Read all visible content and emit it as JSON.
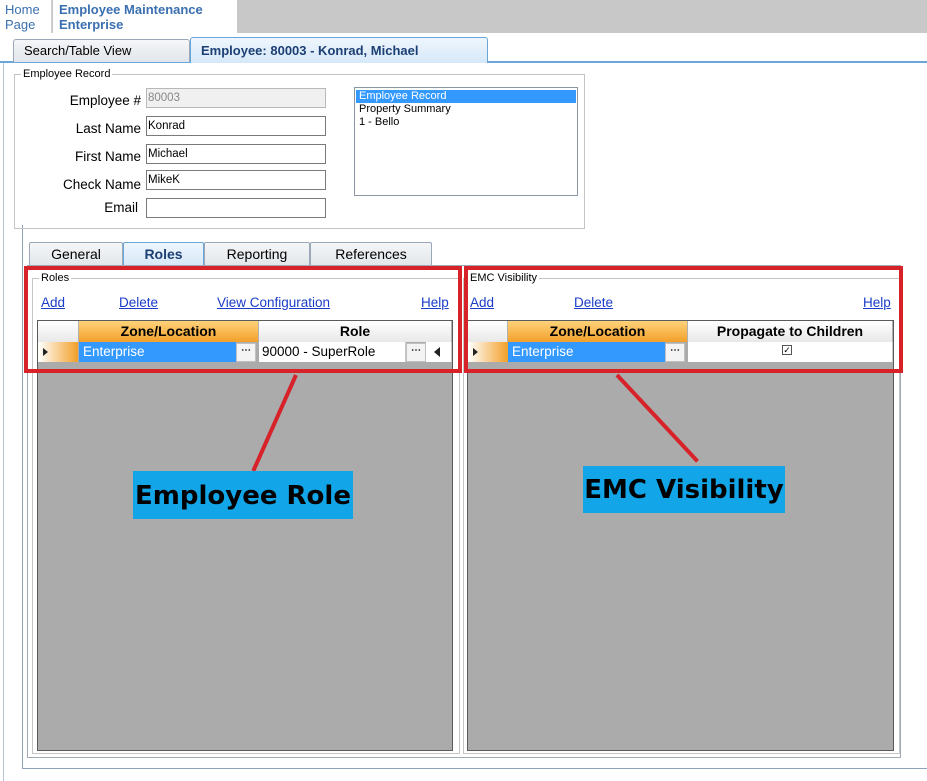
{
  "breadcrumb": {
    "home_line1": "Home",
    "home_line2": "Page",
    "current_line1": "Employee Maintenance",
    "current_line2": "Enterprise"
  },
  "doc_tabs": {
    "search_label": "Search/Table View",
    "employee_label": "Employee: 80003 - Konrad, Michael"
  },
  "employee_record": {
    "group_label": "Employee Record",
    "fields": {
      "employee_number": {
        "label": "Employee #",
        "value": "80003"
      },
      "last_name": {
        "label": "Last Name",
        "value": "Konrad"
      },
      "first_name": {
        "label": "First Name",
        "value": "Michael"
      },
      "check_name": {
        "label": "Check Name",
        "value": "MikeK"
      },
      "email": {
        "label": "Email",
        "value": ""
      }
    },
    "nav_list": [
      "Employee Record",
      "Property Summary",
      "1 - Bello"
    ],
    "nav_selected_index": 0
  },
  "sub_tabs": {
    "general": "General",
    "roles": "Roles",
    "reporting": "Reporting",
    "references": "References",
    "active": "Roles"
  },
  "roles_panel": {
    "group_label": "Roles",
    "add": "Add",
    "delete": "Delete",
    "view_configuration": "View Configuration",
    "help": "Help",
    "columns": [
      "Zone/Location",
      "Role"
    ],
    "rows": [
      {
        "zone": "Enterprise",
        "role": "90000 - SuperRole"
      }
    ]
  },
  "emc_panel": {
    "group_label": "EMC Visibility",
    "add": "Add",
    "delete": "Delete",
    "help": "Help",
    "columns": [
      "Zone/Location",
      "Propagate to Children"
    ],
    "rows": [
      {
        "zone": "Enterprise",
        "propagate": true
      }
    ]
  },
  "annotations": {
    "employee_role": "Employee Role",
    "emc_visibility": "EMC Visibility",
    "highlight_color": "#d7222a",
    "callout_color": "#12a6e8"
  },
  "icons": {
    "ellipsis": "⋯",
    "row_pointer": "triangle-right",
    "checkbox_checked": "✓"
  }
}
